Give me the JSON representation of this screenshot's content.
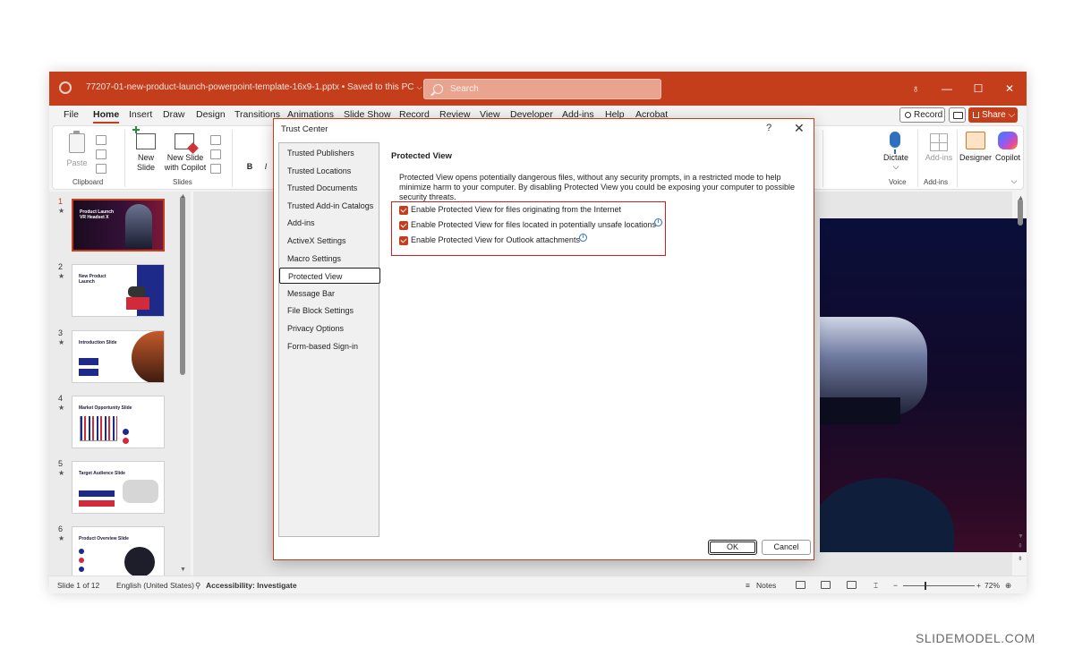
{
  "titlebar": {
    "filename": "77207-01-new-product-launch-powerpoint-template-16x9-1.pptx • Saved to this PC",
    "search_placeholder": "Search",
    "minimize": "—",
    "maximize": "☐",
    "close": "✕"
  },
  "menubar": {
    "tabs": [
      "File",
      "Home",
      "Insert",
      "Draw",
      "Design",
      "Transitions",
      "Animations",
      "Slide Show",
      "Record",
      "Review",
      "View",
      "Developer",
      "Add-ins",
      "Help",
      "Acrobat"
    ],
    "active_tab": "Home",
    "record_label": "Record",
    "share_label": "Share"
  },
  "ribbon": {
    "paste_label": "Paste",
    "clipboard_label": "Clipboard",
    "new_slide_label": "New Slide",
    "new_slide_copilot_label": "New Slide with Copilot",
    "slides_label": "Slides",
    "dictate_label": "Dictate",
    "voice_label": "Voice",
    "addins_label": "Add-ins",
    "addins_group_label": "Add-ins",
    "designer_label": "Designer",
    "copilot_label": "Copilot"
  },
  "thumbnails": [
    {
      "num": "1",
      "title": "Product Launch VR Headset X",
      "selected": true
    },
    {
      "num": "2",
      "title": "New Product Launch",
      "selected": false
    },
    {
      "num": "3",
      "title": "Introduction Slide",
      "selected": false
    },
    {
      "num": "4",
      "title": "Market Opportunity Slide",
      "selected": false
    },
    {
      "num": "5",
      "title": "Target Audience Slide",
      "selected": false
    },
    {
      "num": "6",
      "title": "Product Overview Slide",
      "selected": false
    }
  ],
  "statusbar": {
    "slide_info": "Slide 1 of 12",
    "language": "English (United States)",
    "accessibility": "Accessibility: Investigate",
    "notes": "Notes",
    "zoom": "72%"
  },
  "dialog": {
    "title": "Trust Center",
    "help": "?",
    "close": "✕",
    "nav_items": [
      "Trusted Publishers",
      "Trusted Locations",
      "Trusted Documents",
      "Trusted Add-in Catalogs",
      "Add-ins",
      "ActiveX Settings",
      "Macro Settings",
      "Protected View",
      "Message Bar",
      "File Block Settings",
      "Privacy Options",
      "Form-based Sign-in"
    ],
    "selected_nav": "Protected View",
    "section_title": "Protected View",
    "description": "Protected View opens potentially dangerous files, without any security prompts, in a restricted mode to help minimize harm to your computer. By disabling Protected View you could be exposing your computer to possible security threats.",
    "options": [
      {
        "label": "Enable Protected View for files originating from the Internet",
        "checked": true
      },
      {
        "label": "Enable Protected View for files located in potentially unsafe locations",
        "checked": true
      },
      {
        "label": "Enable Protected View for Outlook attachments",
        "checked": true
      }
    ],
    "ok_label": "OK",
    "cancel_label": "Cancel"
  },
  "watermark": "SLIDEMODEL.COM",
  "colors": {
    "accent": "#c43e1c",
    "highlight_box": "#d11f1f",
    "info_icon": "#2f6fc0"
  }
}
